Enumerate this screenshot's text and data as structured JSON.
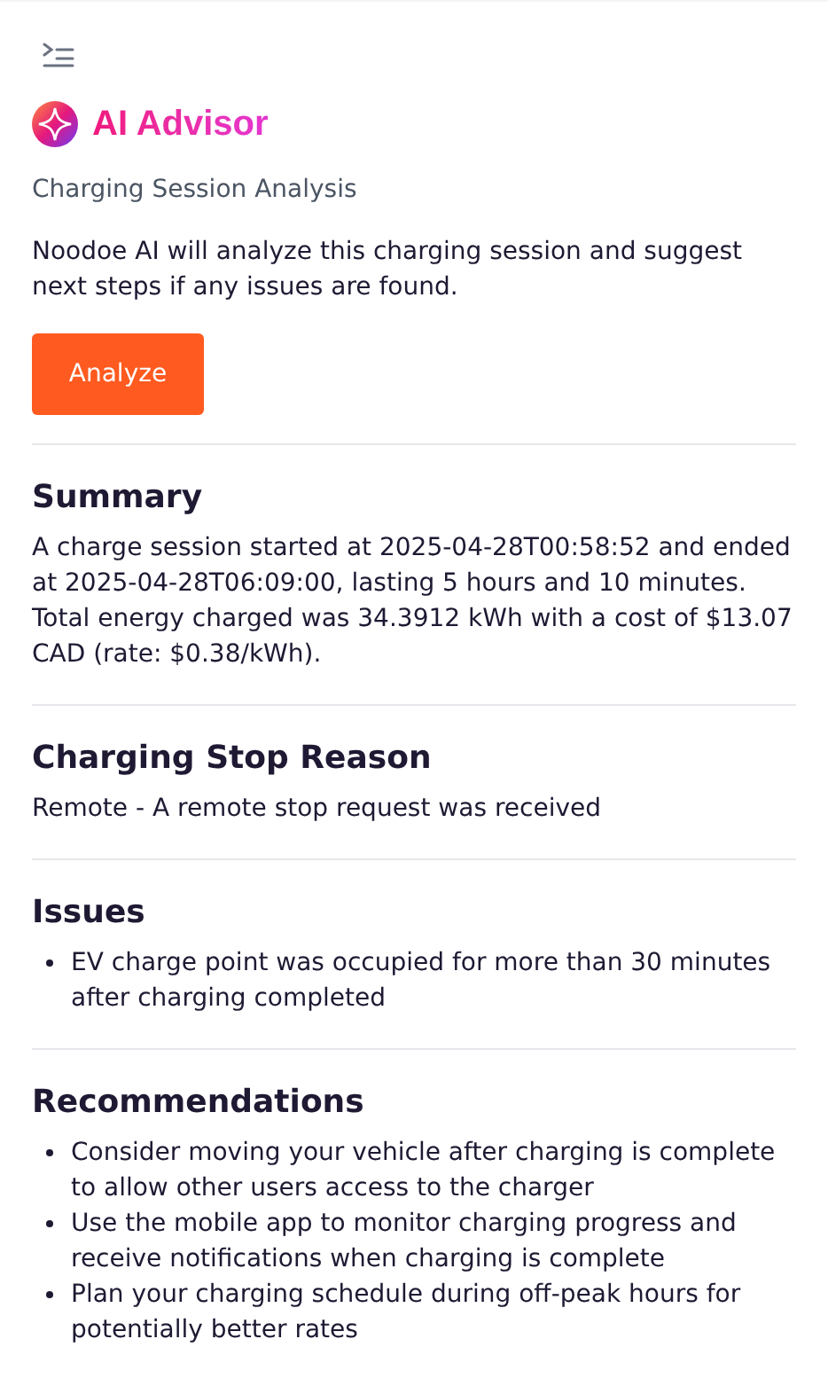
{
  "header": {
    "title": "AI Advisor",
    "subtitle": "Charging Session Analysis",
    "intro": "Noodoe AI will analyze this charging session and suggest next steps if any issues are found.",
    "button": "Analyze"
  },
  "sections": [
    {
      "title": "Summary",
      "kind": "paragraph",
      "text": "A charge session started at 2025-04-28T00:58:52 and ended at 2025-04-28T06:09:00, lasting 5 hours and 10 minutes. Total energy charged was 34.3912 kWh with a cost of $13.07 CAD (rate: $0.38/kWh)."
    },
    {
      "title": "Charging Stop Reason",
      "kind": "paragraph",
      "text": "Remote - A remote stop request was received"
    },
    {
      "title": "Issues",
      "kind": "list",
      "items": [
        "EV charge point was occupied for more than 30 minutes after charging completed"
      ]
    },
    {
      "title": "Recommendations",
      "kind": "list",
      "items": [
        "Consider moving your vehicle after charging is complete to allow other users access to the charger",
        "Use the mobile app to monitor charging progress and receive notifications when charging is complete",
        "Plan your charging schedule during off-peak hours for potentially better rates"
      ]
    }
  ]
}
